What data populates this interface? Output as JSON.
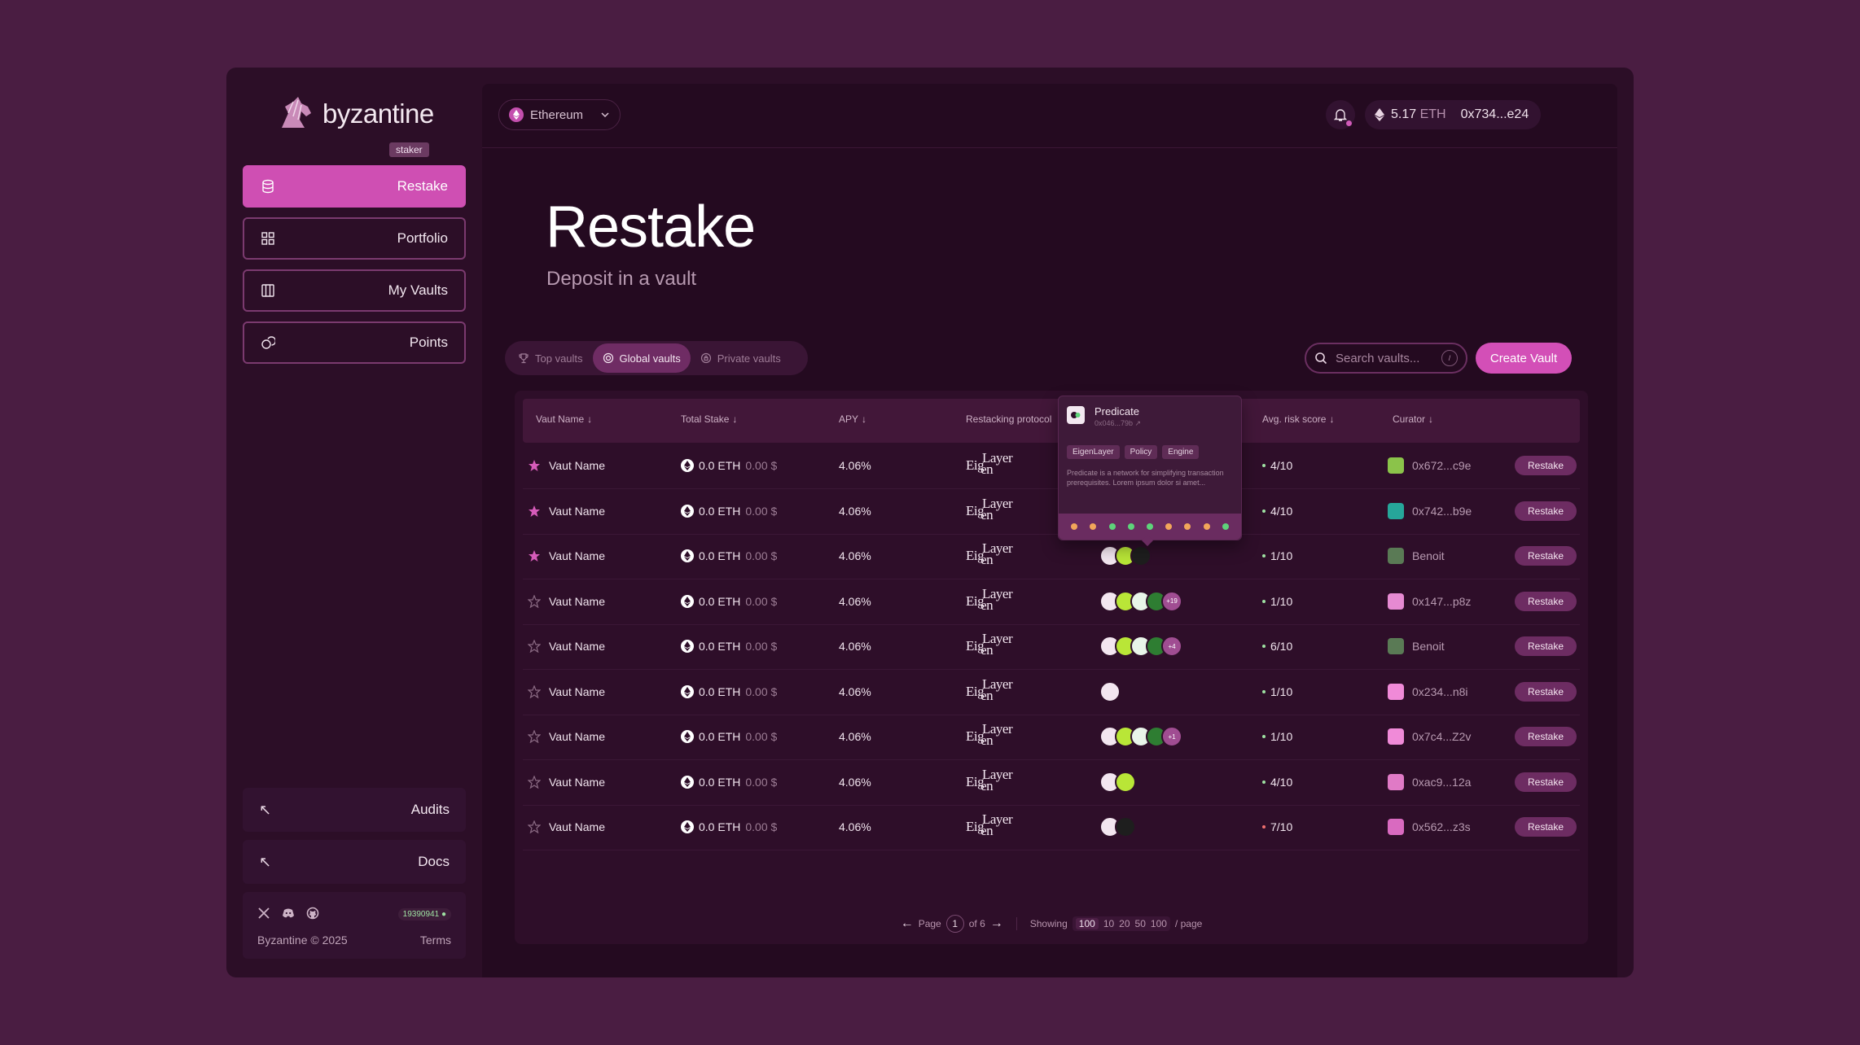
{
  "brand": {
    "name": "byzantine",
    "sub": "staker"
  },
  "nav": [
    {
      "label": "Restake",
      "icon": "database-icon",
      "active": true
    },
    {
      "label": "Portfolio",
      "icon": "grid-icon",
      "active": false
    },
    {
      "label": "My Vaults",
      "icon": "vault-icon",
      "active": false
    },
    {
      "label": "Points",
      "icon": "coins-icon",
      "active": false
    }
  ],
  "bottom_links": [
    {
      "label": "Audits",
      "icon": "arrow-up-left-icon"
    },
    {
      "label": "Docs",
      "icon": "arrow-up-left-icon"
    }
  ],
  "footer": {
    "block": "19390941",
    "copyright": "Byzantine © 2025",
    "terms": "Terms"
  },
  "topbar": {
    "network": "Ethereum",
    "balance_value": "5.17",
    "balance_unit": "ETH",
    "address": "0x734...e24"
  },
  "page": {
    "title": "Restake",
    "subtitle": "Deposit in a vault"
  },
  "tabs": [
    {
      "label": "Top vaults",
      "icon": "trophy-icon",
      "active": false
    },
    {
      "label": "Global vaults",
      "icon": "globe-icon",
      "active": true
    },
    {
      "label": "Private vaults",
      "icon": "lock-icon",
      "active": false
    }
  ],
  "search": {
    "placeholder": "Search vaults...",
    "shortcut": "/"
  },
  "create_vault": "Create Vault",
  "columns": [
    "Vaut Name",
    "Total Stake",
    "APY",
    "Restacking protocol",
    "Avg. risk score",
    "Curator"
  ],
  "protocol_text": {
    "a": "Eig",
    "b": "en",
    "sup": "Layer"
  },
  "rows": [
    {
      "starred": true,
      "name": "Vaut Name",
      "stake": "0.0 ETH",
      "usd": "0.00 $",
      "apy": "4.06%",
      "avs": [
        "#f3e6f0",
        "#b9e637",
        "#2a2a2a"
      ],
      "extra": "",
      "risk": "4/10",
      "risk_color": "#9fe3a3",
      "curator": "0x672...c9e",
      "curator_color": "#8bc34a",
      "action": "Restake"
    },
    {
      "starred": true,
      "name": "Vaut Name",
      "stake": "0.0 ETH",
      "usd": "0.00 $",
      "apy": "4.06%",
      "avs": [
        "#f3e6f0",
        "#b9e637"
      ],
      "extra": "",
      "risk": "4/10",
      "risk_color": "#9fe3a3",
      "curator": "0x742...b9e",
      "curator_color": "#26a69a",
      "action": "Restake"
    },
    {
      "starred": true,
      "name": "Vaut Name",
      "stake": "0.0 ETH",
      "usd": "0.00 $",
      "apy": "4.06%",
      "avs": [
        "#f3e6f0",
        "#b9e637",
        "#1e1e1e"
      ],
      "extra": "",
      "risk": "1/10",
      "risk_color": "#9fe3a3",
      "curator": "Benoit",
      "curator_color": "#5a7a55",
      "action": "Restake"
    },
    {
      "starred": false,
      "name": "Vaut Name",
      "stake": "0.0 ETH",
      "usd": "0.00 $",
      "apy": "4.06%",
      "avs": [
        "#f3e6f0",
        "#b9e637",
        "#e8f5e9",
        "#2e7d32"
      ],
      "extra": "+19",
      "risk": "1/10",
      "risk_color": "#9fe3a3",
      "curator": "0x147...p8z",
      "curator_color": "#e68ad2",
      "action": "Restake"
    },
    {
      "starred": false,
      "name": "Vaut Name",
      "stake": "0.0 ETH",
      "usd": "0.00 $",
      "apy": "4.06%",
      "avs": [
        "#f3e6f0",
        "#b9e637",
        "#e8f5e9",
        "#2e7d32"
      ],
      "extra": "+4",
      "risk": "6/10",
      "risk_color": "#9fe3a3",
      "curator": "Benoit",
      "curator_color": "#5a7a55",
      "action": "Restake"
    },
    {
      "starred": false,
      "name": "Vaut Name",
      "stake": "0.0 ETH",
      "usd": "0.00 $",
      "apy": "4.06%",
      "avs": [
        "#f3e6f0"
      ],
      "extra": "",
      "risk": "1/10",
      "risk_color": "#9fe3a3",
      "curator": "0x234...n8i",
      "curator_color": "#f08ad8",
      "action": "Restake"
    },
    {
      "starred": false,
      "name": "Vaut Name",
      "stake": "0.0 ETH",
      "usd": "0.00 $",
      "apy": "4.06%",
      "avs": [
        "#f3e6f0",
        "#b9e637",
        "#e8f5e9",
        "#2e7d32"
      ],
      "extra": "+1",
      "risk": "1/10",
      "risk_color": "#9fe3a3",
      "curator": "0x7c4...Z2v",
      "curator_color": "#f08ad8",
      "action": "Restake"
    },
    {
      "starred": false,
      "name": "Vaut Name",
      "stake": "0.0 ETH",
      "usd": "0.00 $",
      "apy": "4.06%",
      "avs": [
        "#f3e6f0",
        "#b9e637"
      ],
      "extra": "",
      "risk": "4/10",
      "risk_color": "#9fe3a3",
      "curator": "0xac9...12a",
      "curator_color": "#e07ac6",
      "action": "Restake"
    },
    {
      "starred": false,
      "name": "Vaut Name",
      "stake": "0.0 ETH",
      "usd": "0.00 $",
      "apy": "4.06%",
      "avs": [
        "#f3e6f0",
        "#1e1e1e"
      ],
      "extra": "",
      "risk": "7/10",
      "risk_color": "#ef6f6f",
      "curator": "0x562...z3s",
      "curator_color": "#d96ac0",
      "action": "Restake"
    }
  ],
  "tooltip": {
    "title": "Predicate",
    "address": "0x046...79b",
    "tags": [
      "EigenLayer",
      "Policy",
      "Engine"
    ],
    "description": "Predicate is a network for simplifying transaction prerequisites. Lorem ipsum dolor si amet...",
    "dots": [
      "#f2a65a",
      "#f2a65a",
      "#5ed37a",
      "#5ed37a",
      "#5ed37a",
      "#f2a65a",
      "#f2a65a",
      "#f2a65a",
      "#5ed37a"
    ]
  },
  "pagination": {
    "page_label": "Page",
    "page": "1",
    "of_label": "of 6",
    "showing_label": "Showing",
    "selected": "100",
    "options": [
      "10",
      "20",
      "50",
      "100"
    ],
    "per_page": "/ page"
  },
  "colors": {
    "accent": "#d34fb7",
    "background": "#4a1d42",
    "panel": "#2c0e27"
  }
}
